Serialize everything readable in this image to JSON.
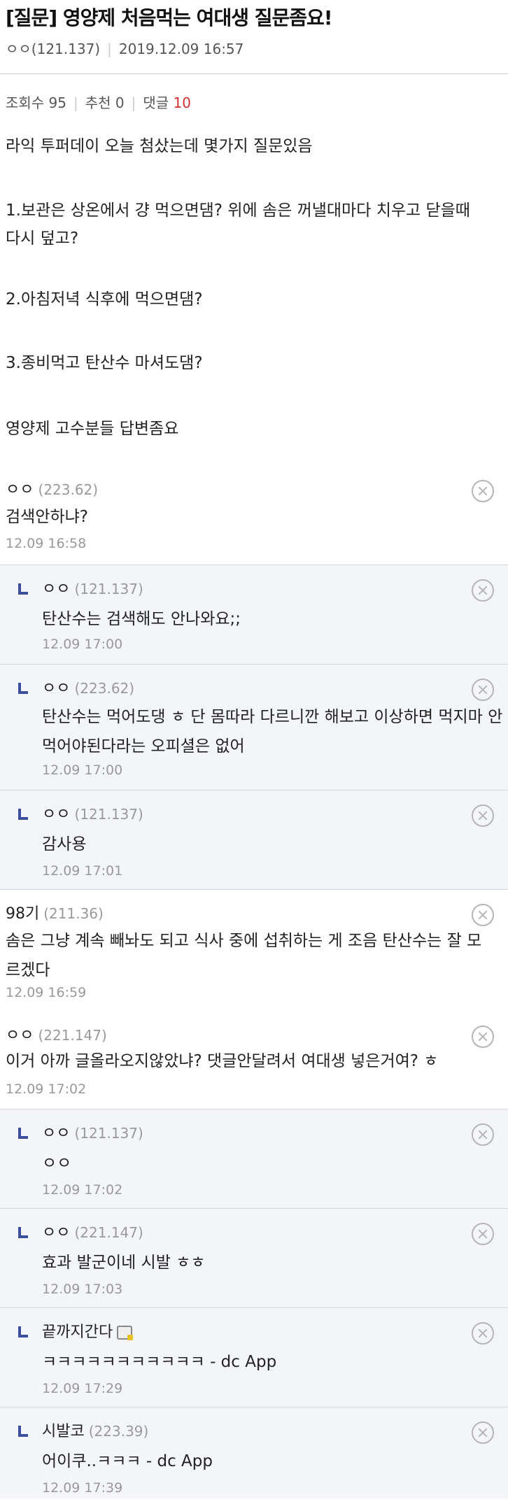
{
  "post": {
    "title": "[질문] 영양제 처음먹는 여대생 질문좀요!",
    "author": "ㅇㅇ(121.137)",
    "datetime": "2019.12.09 16:57",
    "views_label": "조회수 95",
    "recommend_label": "추천 0",
    "comments_label": "댓글",
    "comments_count": "10",
    "body_lines": [
      "라익 투퍼데이 오늘 첨샀는데 몇가지 질문있음",
      "1.보관은 상온에서 걍 먹으면댐? 위에 솜은 꺼낼대마다 치우고 닫을때",
      "다시 덮고?",
      "2.아침저녁 식후에 먹으면댐?",
      "3.종비먹고 탄산수 마셔도댐?",
      "영양제 고수분들 답변좀요"
    ]
  },
  "comments": [
    {
      "nick": "ㅇㅇ",
      "ip": "(223.62)",
      "text": "검색안하냐?",
      "date": "12.09 16:58"
    },
    {
      "nick": "ㅇㅇ",
      "ip": "(121.137)",
      "text": "탄산수는 검색해도 안나와요;;",
      "date": "12.09 17:00"
    },
    {
      "nick": "ㅇㅇ",
      "ip": "(223.62)",
      "text": "탄산수는 먹어도댕 ㅎ 단 몸따라 다르니깐 해보고 이상하면 먹지마 안먹어야된다라는 오피셜은 없어",
      "date": "12.09 17:00"
    },
    {
      "nick": "ㅇㅇ",
      "ip": "(121.137)",
      "text": "감사용",
      "date": "12.09 17:01"
    },
    {
      "nick": "98기",
      "ip": "(211.36)",
      "text": "솜은 그냥 계속 빼놔도 되고 식사 중에 섭취하는 게 조음 탄산수는 잘 모르겠다",
      "date": "12.09 16:59"
    },
    {
      "nick": "ㅇㅇ",
      "ip": "(221.147)",
      "text": "이거 아까 글올라오지않았냐? 댓글안달려서 여대생 넣은거여? ㅎ",
      "date": "12.09 17:02"
    },
    {
      "nick": "ㅇㅇ",
      "ip": "(121.137)",
      "text": "ㅇㅇ",
      "date": "12.09 17:02"
    },
    {
      "nick": "ㅇㅇ",
      "ip": "(221.147)",
      "text": "효과 발군이네 시발 ㅎㅎ",
      "date": "12.09 17:03"
    },
    {
      "nick": "끝까지간다",
      "ip": "",
      "text": "ㅋㅋㅋㅋㅋㅋㅋㅋㅋㅋㅋ - dc App",
      "date": "12.09 17:29"
    },
    {
      "nick": "시발코",
      "ip": "(223.39)",
      "text": "어이쿠..ㅋㅋㅋ - dc App",
      "date": "12.09 17:39"
    }
  ]
}
